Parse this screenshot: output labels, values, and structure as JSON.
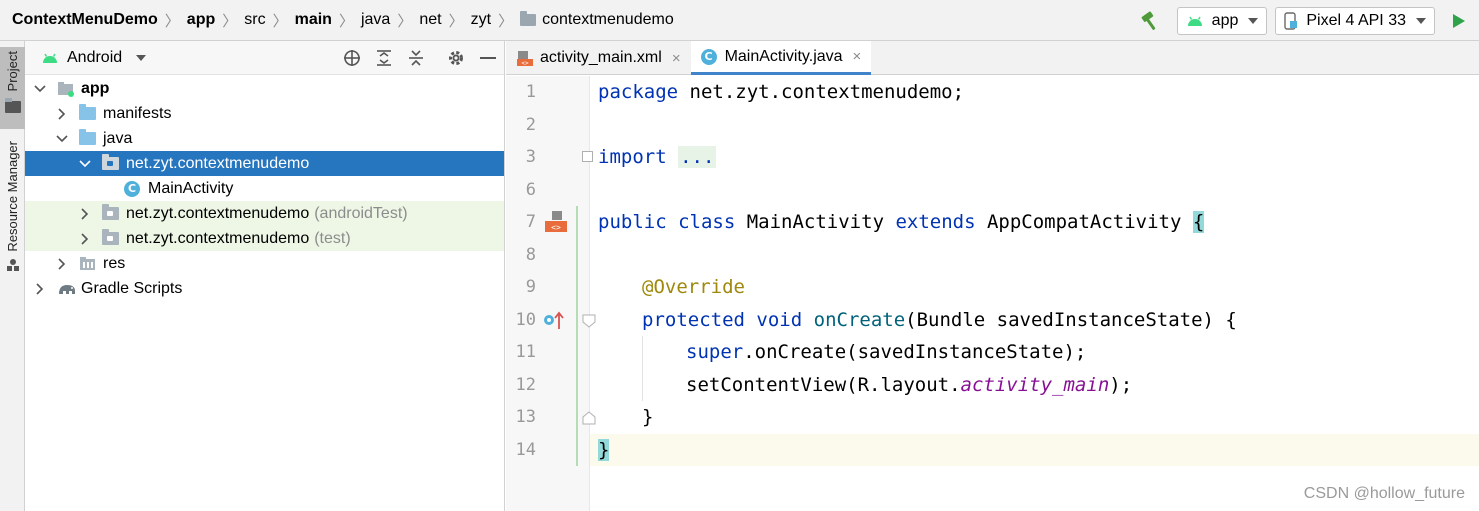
{
  "breadcrumb": {
    "items": [
      "ContextMenuDemo",
      "app",
      "src",
      "main",
      "java",
      "net",
      "zyt",
      "contextmenudemo"
    ]
  },
  "toolbar": {
    "run_config": "app",
    "device": "Pixel 4 API 33"
  },
  "toolstrip": {
    "project_tab": "Project",
    "resource_tab": "Resource Manager"
  },
  "project_panel": {
    "view": "Android",
    "tree": [
      {
        "label": "app",
        "level": 0
      },
      {
        "label": "manifests",
        "level": 1
      },
      {
        "label": "java",
        "level": 1
      },
      {
        "label": "net.zyt.contextmenudemo",
        "level": 2
      },
      {
        "label": "MainActivity",
        "level": 3
      },
      {
        "label": "net.zyt.contextmenudemo",
        "suffix": "(androidTest)",
        "level": 2
      },
      {
        "label": "net.zyt.contextmenudemo",
        "suffix": "(test)",
        "level": 2
      },
      {
        "label": "res",
        "level": 1
      },
      {
        "label": "Gradle Scripts",
        "level": 0
      }
    ]
  },
  "editor": {
    "tabs": [
      {
        "label": "activity_main.xml",
        "close": "×"
      },
      {
        "label": "MainActivity.java",
        "close": "×"
      }
    ],
    "line_numbers": [
      "1",
      "2",
      "3",
      "6",
      "7",
      "8",
      "9",
      "10",
      "11",
      "12",
      "13",
      "14"
    ],
    "code": {
      "l1": [
        "package",
        " net.zyt.contextmenudemo;"
      ],
      "l3": [
        "import",
        " ",
        "..."
      ],
      "l7": [
        "public",
        " ",
        "class",
        " MainActivity ",
        "extends",
        " AppCompatActivity ",
        "{"
      ],
      "l9": [
        "@Override"
      ],
      "l10": [
        "protected",
        " ",
        "void",
        " ",
        "onCreate",
        "(Bundle savedInstanceState) {"
      ],
      "l11": [
        "super",
        ".onCreate(savedInstanceState);"
      ],
      "l12": [
        "setContentView(R.layout.",
        "activity_main",
        ");"
      ],
      "l13": [
        "}"
      ],
      "l14": [
        "}"
      ]
    }
  },
  "watermark": "CSDN @hollow_future",
  "colors": {
    "selection": "#2675bf",
    "keyword": "#0033b3",
    "annotation": "#9e880d",
    "method": "#00627a",
    "field": "#871094",
    "run": "#2fa34a"
  }
}
